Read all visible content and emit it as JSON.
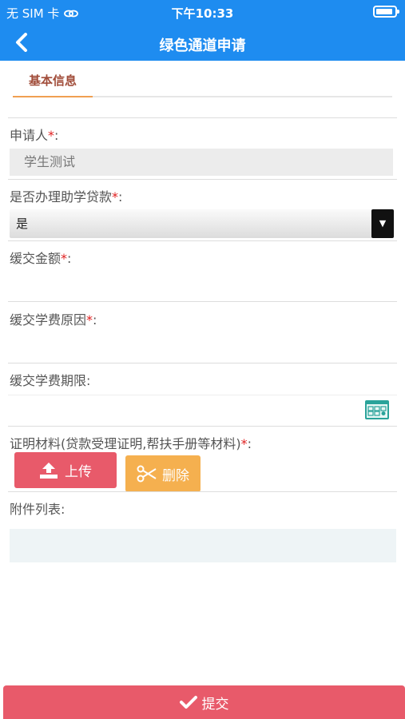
{
  "status_bar": {
    "carrier": "无 SIM 卡",
    "time": "下午10:33"
  },
  "nav": {
    "title": "绿色通道申请"
  },
  "tabs": [
    {
      "label": "基本信息",
      "active": true
    }
  ],
  "form": {
    "applicant": {
      "label": "申请人",
      "required_mark": "*",
      "suffix": ":",
      "value": "学生测试"
    },
    "student_loan": {
      "label": "是否办理助学贷款",
      "required_mark": "*",
      "suffix": ":",
      "value": "是"
    },
    "deferred_amount": {
      "label": "缓交金额",
      "required_mark": "*",
      "suffix": ":",
      "value": ""
    },
    "deferred_reason": {
      "label": "缓交学费原因",
      "required_mark": "*",
      "suffix": ":",
      "value": ""
    },
    "deferred_deadline": {
      "label": "缓交学费期限",
      "suffix": ":",
      "value": ""
    },
    "proof_materials": {
      "label": "证明材料(贷款受理证明,帮扶手册等材料)",
      "required_mark": "*",
      "suffix": ":"
    },
    "attachments": {
      "label": "附件列表",
      "suffix": ":"
    }
  },
  "buttons": {
    "upload": "上传",
    "delete": "删除",
    "submit": "提交"
  },
  "colors": {
    "nav_blue": "#1e8cf0",
    "tab_active_text": "#a14d3a",
    "tab_underline": "#f0a052",
    "required_red": "#e02020",
    "upload_red": "#e85a6a",
    "delete_orange": "#f5b04f",
    "submit_red": "#e85a6a"
  },
  "icons": {
    "back": "chevron-left-icon",
    "wifi": "link-icon",
    "battery": "battery-icon",
    "upload": "upload-icon",
    "delete": "scissors-icon",
    "submit": "checkmark-icon",
    "calendar": "calendar-icon",
    "dropdown": "triangle-down-icon"
  }
}
